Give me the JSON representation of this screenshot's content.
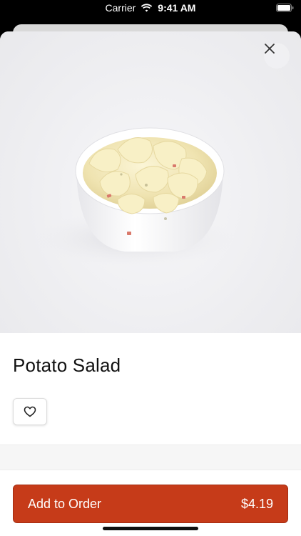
{
  "status_bar": {
    "carrier": "Carrier",
    "time": "9:41 AM",
    "wifi_icon": "wifi-icon",
    "battery_icon": "battery-icon"
  },
  "product": {
    "name": "Potato Salad",
    "image_subject": "potato-salad-bowl-photo"
  },
  "actions": {
    "close_icon": "close-icon",
    "favorite_icon": "heart-icon",
    "add_to_order_label": "Add to Order",
    "price": "$4.19"
  },
  "colors": {
    "accent": "#c63b19",
    "background": "#ffffff",
    "text": "#111111"
  }
}
